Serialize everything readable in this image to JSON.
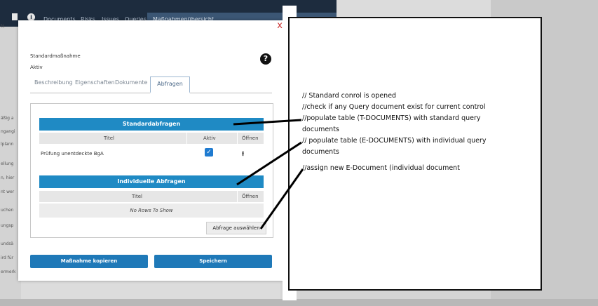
{
  "nav": {
    "items": [
      "Documents",
      "Risks",
      "Issues",
      "Queries",
      "Maßnahmenübersicht"
    ]
  },
  "sidebar_fragments": [
    "ts",
    "äßig a",
    "ngangi",
    "lplann",
    "ellung",
    "n, hier",
    "nt wer",
    "uchen",
    "ungsp",
    "undsä",
    "ird für",
    "ermerk"
  ],
  "modal": {
    "close": "x",
    "kind": "Standardmaßnahme",
    "status": "Aktiv",
    "help": "?",
    "tabs": [
      "Beschreibung",
      "Eigenschaften",
      "Dokumente",
      "Abfragen"
    ],
    "active_tab": "Abfragen",
    "standard": {
      "title": "Standardabfragen",
      "columns": [
        "Titel",
        "Aktiv",
        "Öffnen"
      ],
      "rows": [
        {
          "title": "Prüfung unentdeckte BgA",
          "active": true
        }
      ]
    },
    "individual": {
      "title": "Individuelle Abfragen",
      "columns": [
        "Titel",
        "Öffnen"
      ],
      "empty": "No Rows To Show"
    },
    "select_button": "Abfrage auswählen",
    "copy_button": "Maßnahme kopieren",
    "save_button": "Speichern"
  },
  "annotation": {
    "lines": [
      "// Standard conrol is opened",
      "//check if any Query document exist for current control",
      "//populate table (T-DOCUMENTS) with standard query",
      "documents",
      "// populate table (E-DOCUMENTS) with individual query",
      "documents",
      "//assign new E-Document (individual document"
    ]
  },
  "colors": {
    "header_blue": "#1f8ac4",
    "button_blue": "#1f79b8",
    "nav_bg": "#1d2c3e"
  }
}
